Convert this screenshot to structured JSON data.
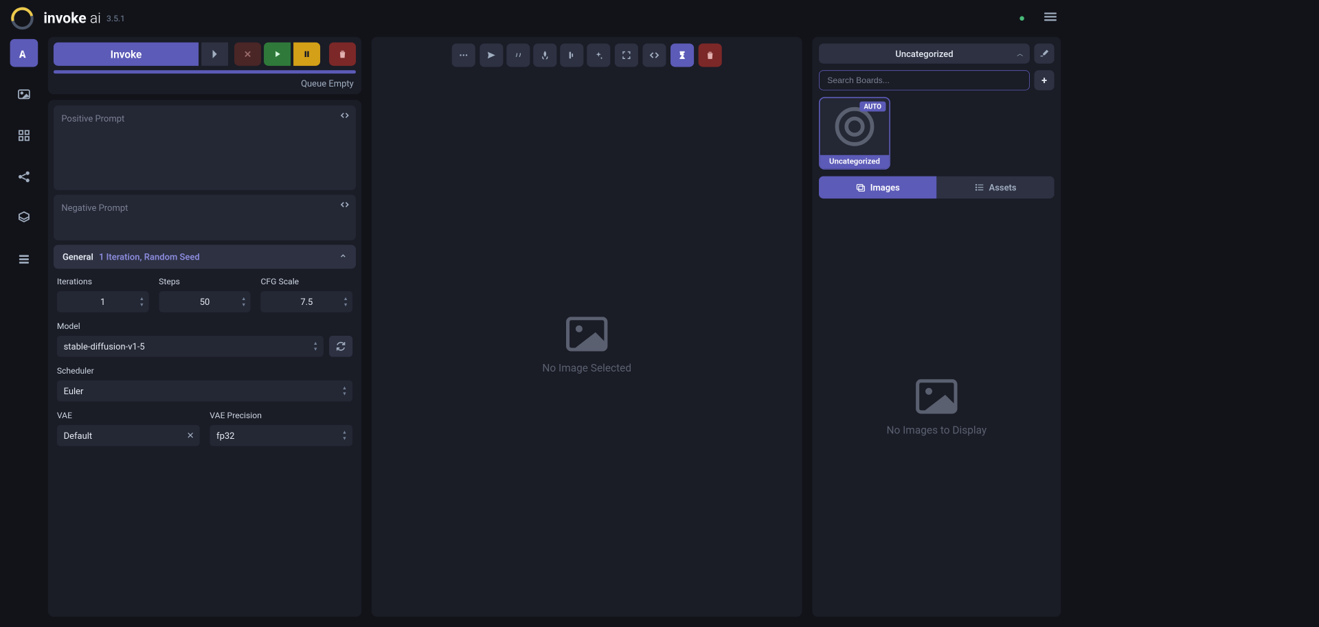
{
  "app": {
    "brand_bold": "invoke",
    "brand_light": " ai",
    "version": "3.5.1"
  },
  "invoke": {
    "button": "Invoke",
    "queue_status": "Queue Empty"
  },
  "prompts": {
    "positive_placeholder": "Positive Prompt",
    "negative_placeholder": "Negative Prompt"
  },
  "general": {
    "title": "General",
    "subtitle": "1 Iteration, Random Seed",
    "iterations_label": "Iterations",
    "iterations_value": "1",
    "steps_label": "Steps",
    "steps_value": "50",
    "cfg_label": "CFG Scale",
    "cfg_value": "7.5",
    "model_label": "Model",
    "model_value": "stable-diffusion-v1-5",
    "scheduler_label": "Scheduler",
    "scheduler_value": "Euler",
    "vae_label": "VAE",
    "vae_value": "Default",
    "vae_precision_label": "VAE Precision",
    "vae_precision_value": "fp32"
  },
  "viewer": {
    "no_image": "No Image Selected"
  },
  "boards": {
    "selected": "Uncategorized",
    "search_placeholder": "Search Boards...",
    "card_badge": "AUTO",
    "card_label": "Uncategorized"
  },
  "tabs": {
    "images": "Images",
    "assets": "Assets"
  },
  "gallery": {
    "empty": "No Images to Display"
  }
}
